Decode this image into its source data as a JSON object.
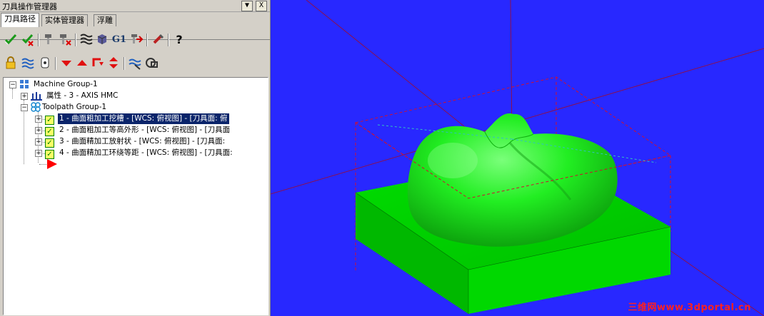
{
  "title": "刀具操作管理器",
  "title_buttons": {
    "pin": "▼",
    "close": "X"
  },
  "tabs": [
    {
      "label": "刀具路径",
      "active": true
    },
    {
      "label": "实体管理器",
      "active": false
    },
    {
      "label": "浮雕",
      "active": false
    }
  ],
  "toolbar1": [
    "select-all-icon",
    "select-failed-icon",
    "regen-all-icon",
    "regen-dirty-icon",
    "backplot-icon",
    "verify-icon",
    "g1-post-icon",
    "post-icon",
    "high-speed-icon",
    "help-icon"
  ],
  "toolbar1_labels": {
    "g1": "G1",
    "help": "?"
  },
  "toolbar2": [
    "lock-icon",
    "toolpath-display-icon",
    "post-lock-icon",
    "move-down-icon",
    "move-up-icon",
    "insert-arrow-icon",
    "scroll-icon",
    "only-selected-icon",
    "view-icon"
  ],
  "tree": {
    "machine_group": "Machine Group-1",
    "properties": "属性 - 3 - AXIS HMC",
    "toolpath_group": "Toolpath Group-1",
    "operations": [
      {
        "label": "1 - 曲面粗加工挖槽 - [WCS: 俯视图] - [刀具面: 俯",
        "selected": true
      },
      {
        "label": "2 - 曲面粗加工等高外形 - [WCS: 俯视图] - [刀具面",
        "selected": false
      },
      {
        "label": "3 - 曲面精加工放射状 - [WCS: 俯视图] - [刀具面:",
        "selected": false
      },
      {
        "label": "4 - 曲面精加工环绕等距 - [WCS: 俯视图] - [刀具面:",
        "selected": false
      }
    ]
  },
  "viewport": {
    "background": "#2828ff",
    "model_color": "#00ff00",
    "stock_box_color": "#d01030"
  },
  "watermark": "三维网www.3dportal.cn"
}
